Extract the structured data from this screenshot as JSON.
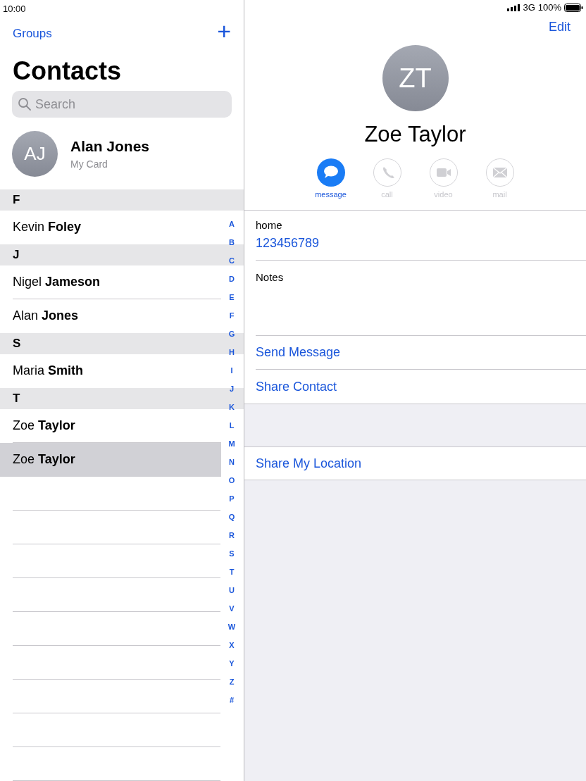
{
  "status_bar": {
    "time": "10:00",
    "network": "3G",
    "battery": "100%"
  },
  "sidebar": {
    "groups_link": "Groups",
    "add_button": "+",
    "title": "Contacts",
    "search": {
      "placeholder": "Search"
    },
    "my_card": {
      "initials": "AJ",
      "name": "Alan Jones",
      "subtitle": "My Card"
    },
    "sections": [
      {
        "letter": "F",
        "contacts": [
          {
            "name": "Kevin **Foley**",
            "selected": false
          }
        ]
      },
      {
        "letter": "J",
        "contacts": [
          {
            "name": "Nigel **Jameson**",
            "selected": false
          },
          {
            "name": "Alan **Jones**",
            "selected": false
          }
        ]
      },
      {
        "letter": "S",
        "contacts": [
          {
            "name": "Maria **Smith**",
            "selected": false
          }
        ]
      },
      {
        "letter": "T",
        "contacts": [
          {
            "name": "Zoe **Taylor**",
            "selected": false
          },
          {
            "name": "Zoe **Taylor**",
            "selected": true
          }
        ]
      }
    ],
    "index": [
      "A",
      "B",
      "C",
      "D",
      "E",
      "F",
      "G",
      "H",
      "I",
      "J",
      "K",
      "L",
      "M",
      "N",
      "O",
      "P",
      "Q",
      "R",
      "S",
      "T",
      "U",
      "V",
      "W",
      "X",
      "Y",
      "Z",
      "#"
    ]
  },
  "detail": {
    "edit_button": "Edit",
    "initials": "ZT",
    "name": "Zoe Taylor",
    "actions": [
      {
        "kind": "message",
        "label": "message",
        "enabled": true
      },
      {
        "kind": "call",
        "label": "call",
        "enabled": false
      },
      {
        "kind": "video",
        "label": "video",
        "enabled": false
      },
      {
        "kind": "mail",
        "label": "mail",
        "enabled": false
      }
    ],
    "phone": {
      "label": "home",
      "value": "123456789"
    },
    "notes_label": "Notes",
    "links": [
      "Send Message",
      "Share Contact"
    ],
    "location_link": "Share My Location"
  }
}
